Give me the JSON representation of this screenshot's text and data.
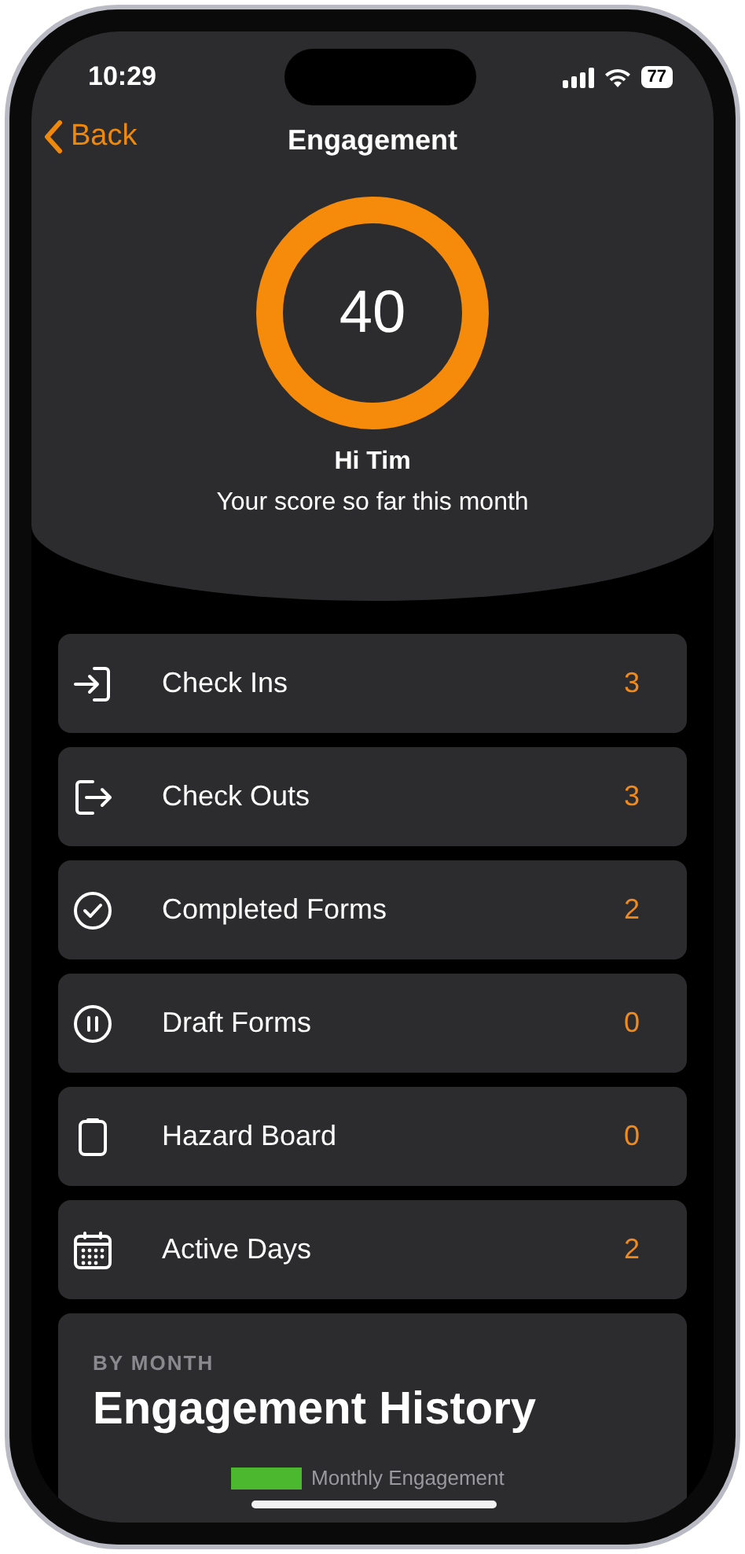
{
  "status_bar": {
    "time": "10:29",
    "battery": "77"
  },
  "nav": {
    "back": "Back",
    "title": "Engagement"
  },
  "score": {
    "value": "40",
    "greeting": "Hi Tim",
    "subtitle": "Your score so far this month"
  },
  "stats": [
    {
      "kind": "check-in",
      "label": "Check Ins",
      "count": "3"
    },
    {
      "kind": "check-out",
      "label": "Check Outs",
      "count": "3"
    },
    {
      "kind": "check-circle",
      "label": "Completed Forms",
      "count": "2"
    },
    {
      "kind": "pause-circle",
      "label": "Draft Forms",
      "count": "0"
    },
    {
      "kind": "clipboard",
      "label": "Hazard Board",
      "count": "0"
    },
    {
      "kind": "calendar",
      "label": "Active Days",
      "count": "2"
    }
  ],
  "history": {
    "eyebrow": "BY MONTH",
    "title": "Engagement History",
    "legend": [
      {
        "label": "Monthly Engagement",
        "color": "#4cb82f"
      }
    ]
  }
}
